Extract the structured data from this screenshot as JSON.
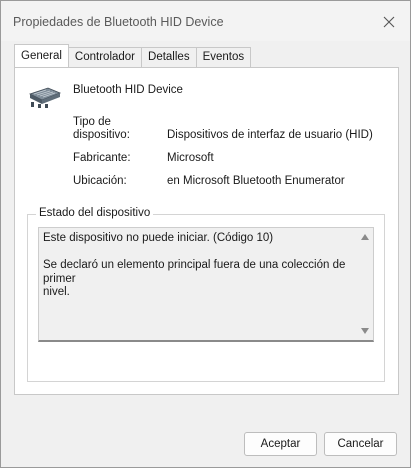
{
  "window": {
    "title": "Propiedades de Bluetooth HID Device"
  },
  "tabs": [
    {
      "label": "General",
      "active": true
    },
    {
      "label": "Controlador",
      "active": false
    },
    {
      "label": "Detalles",
      "active": false
    },
    {
      "label": "Eventos",
      "active": false
    }
  ],
  "device": {
    "name": "Bluetooth HID Device",
    "icon": "bluetooth-hid-device-icon",
    "properties": [
      {
        "label": "Tipo de\ndispositivo:",
        "value": "Dispositivos de interfaz de usuario (HID)"
      },
      {
        "label": "Fabricante:",
        "value": "Microsoft"
      },
      {
        "label": "Ubicación:",
        "value": "en Microsoft Bluetooth Enumerator"
      }
    ]
  },
  "status": {
    "legend": "Estado del dispositivo",
    "text": "Este dispositivo no puede iniciar. (Código 10)\n\nSe declaró un elemento principal fuera de una colección de primer\nnivel."
  },
  "buttons": {
    "ok": "Aceptar",
    "cancel": "Cancelar"
  }
}
